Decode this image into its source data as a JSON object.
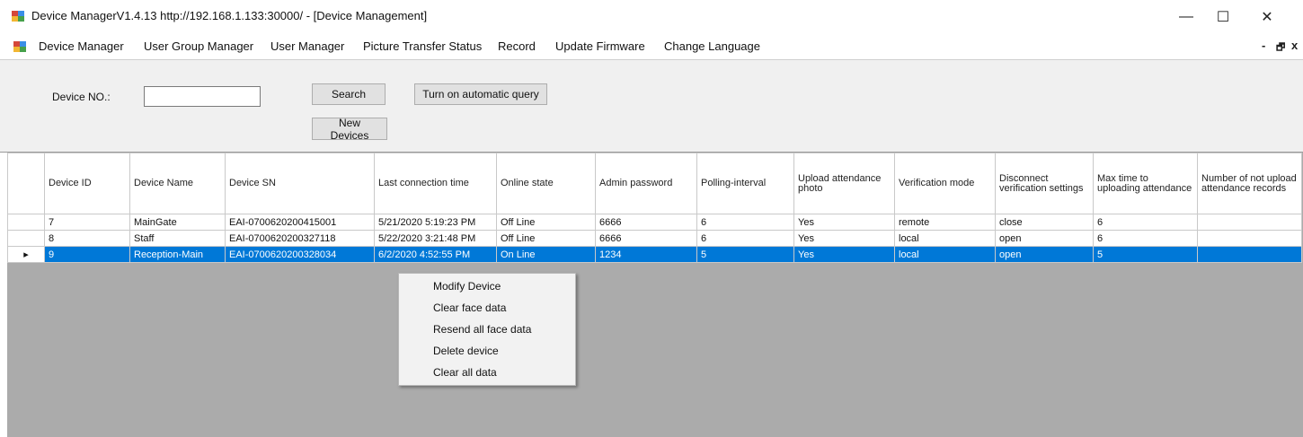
{
  "window": {
    "title": "Device ManagerV1.4.13 http://192.168.1.133:30000/ - [Device Management]",
    "minimize_glyph": "—",
    "maximize_glyph": "☐",
    "close_glyph": "✕"
  },
  "menubar": {
    "items": [
      "Device Manager",
      "User Group Manager",
      "User Manager",
      "Picture Transfer Status",
      "Record",
      "Update Firmware",
      "Change Language"
    ],
    "mdi_minimize": "-",
    "mdi_restore": "🗗",
    "mdi_close": "x"
  },
  "toolbar": {
    "device_no_label": "Device NO.:",
    "device_no_value": "",
    "search_label": "Search",
    "auto_query_label": "Turn on automatic query",
    "new_devices_label": "New Devices"
  },
  "grid": {
    "columns": [
      "Device ID",
      "Device Name",
      "Device SN",
      "Last connection time",
      "Online state",
      "Admin password",
      "Polling-interval",
      "Upload attendance photo",
      "Verification mode",
      "Disconnect verification settings",
      "Max time to uploading attendance",
      "Number of not upload attendance records"
    ],
    "rows": [
      [
        "7",
        "MainGate",
        "EAI-0700620200415001",
        "5/21/2020 5:19:23 PM",
        "Off Line",
        "6666",
        "6",
        "Yes",
        "remote",
        "close",
        "6",
        ""
      ],
      [
        "8",
        "Staff",
        "EAI-0700620200327118",
        "5/22/2020 3:21:48 PM",
        "Off Line",
        "6666",
        "6",
        "Yes",
        "local",
        "open",
        "6",
        ""
      ],
      [
        "9",
        "Reception-Main",
        "EAI-0700620200328034",
        "6/2/2020 4:52:55 PM",
        "On Line",
        "1234",
        "5",
        "Yes",
        "local",
        "open",
        "5",
        ""
      ]
    ],
    "selected_row_marker": "▸"
  },
  "context_menu": {
    "items": [
      "Modify Device",
      "Clear face data",
      "Resend all face data",
      "Delete device",
      "Clear all data"
    ]
  },
  "colors": {
    "selection": "#0078d7",
    "grid_background": "#ababab",
    "panel": "#f0f0f0"
  }
}
